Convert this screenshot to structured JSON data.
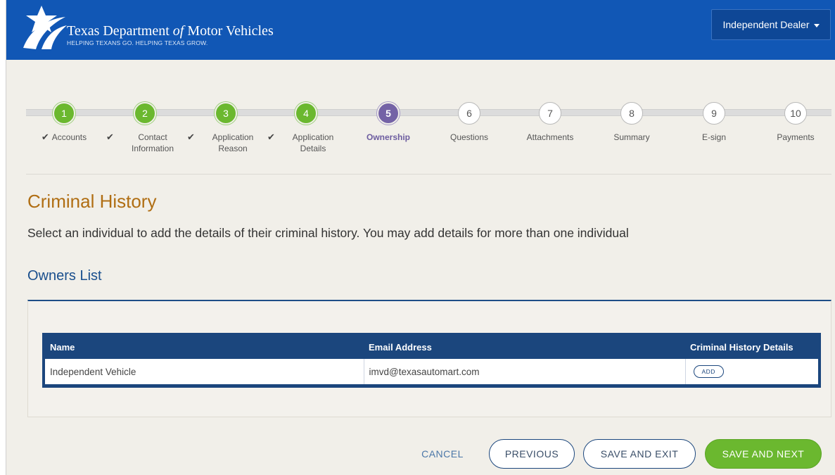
{
  "header": {
    "title_pre": "Texas Department ",
    "title_of": "of",
    "title_post": " Motor Vehicles",
    "tagline": "HELPING TEXANS GO. HELPING TEXAS GROW.",
    "account_menu": "Independent Dealer"
  },
  "steps": [
    {
      "number": "1",
      "label": "Accounts",
      "status": "done"
    },
    {
      "number": "2",
      "label": "Contact Information",
      "status": "done"
    },
    {
      "number": "3",
      "label": "Application Reason",
      "status": "done"
    },
    {
      "number": "4",
      "label": "Application Details",
      "status": "done"
    },
    {
      "number": "5",
      "label": "Ownership",
      "status": "active"
    },
    {
      "number": "6",
      "label": "Questions",
      "status": "todo"
    },
    {
      "number": "7",
      "label": "Attachments",
      "status": "todo"
    },
    {
      "number": "8",
      "label": "Summary",
      "status": "todo"
    },
    {
      "number": "9",
      "label": "E-sign",
      "status": "todo"
    },
    {
      "number": "10",
      "label": "Payments",
      "status": "todo"
    }
  ],
  "page": {
    "title": "Criminal History",
    "intro": "Select an individual to add the details of their criminal history. You may add details for more than one individual",
    "section_title": "Owners List"
  },
  "owners_table": {
    "headers": [
      "Name",
      "Email Address",
      "Criminal History Details"
    ],
    "rows": [
      {
        "name": "Independent Vehicle",
        "email": "imvd@texasautomart.com",
        "action": "ADD"
      }
    ]
  },
  "footer": {
    "cancel": "CANCEL",
    "previous": "PREVIOUS",
    "save_exit": "SAVE AND EXIT",
    "save_next": "SAVE AND NEXT"
  },
  "colors": {
    "header_blue": "#1157b5",
    "done_green": "#6bb82f",
    "active_purple": "#7462a6",
    "title_orange": "#b06e13",
    "table_navy": "#1b467d"
  }
}
